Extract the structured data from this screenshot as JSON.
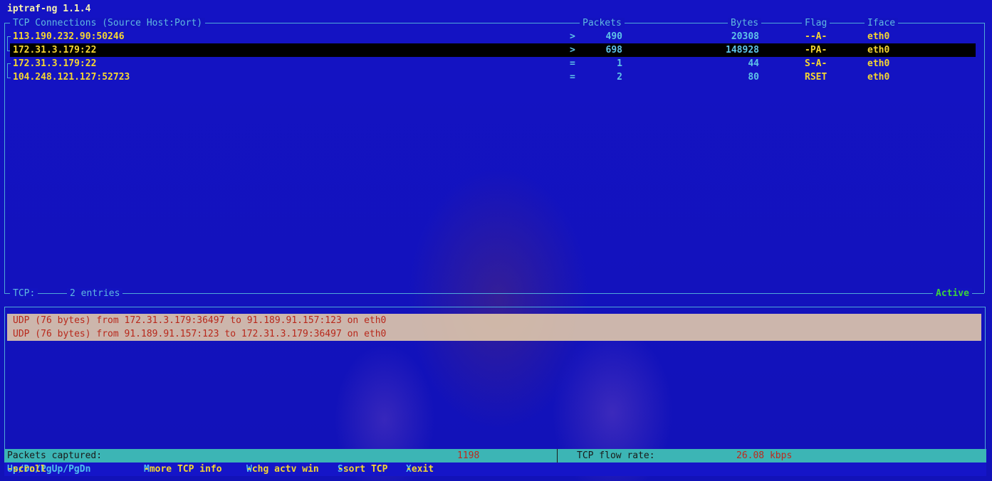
{
  "app": {
    "title": "iptraf-ng 1.1.4"
  },
  "tcp_window": {
    "title": "TCP Connections (Source Host:Port)",
    "columns": {
      "packets": "Packets",
      "bytes": "Bytes",
      "flag": "Flag",
      "iface": "Iface"
    },
    "rows": [
      {
        "host": "113.190.232.90:50246",
        "dir": ">",
        "packets": "490",
        "bytes": "20308",
        "flag": "--A-",
        "iface": "eth0"
      },
      {
        "host": "172.31.3.179:22",
        "dir": ">",
        "packets": "698",
        "bytes": "148928",
        "flag": "-PA-",
        "iface": "eth0"
      },
      {
        "host": "172.31.3.179:22",
        "dir": "=",
        "packets": "1",
        "bytes": "44",
        "flag": "S-A-",
        "iface": "eth0"
      },
      {
        "host": "104.248.121.127:52723",
        "dir": "=",
        "packets": "2",
        "bytes": "80",
        "flag": "RSET",
        "iface": "eth0"
      }
    ],
    "footer_label": "TCP:",
    "footer_entries": "2 entries",
    "footer_status": "Active"
  },
  "other_window": {
    "rows": [
      "UDP (76 bytes) from 172.31.3.179:36497 to 91.189.91.157:123 on eth0",
      "UDP (76 bytes) from 91.189.91.157:123 to 172.31.3.179:36497 on eth0"
    ]
  },
  "status_bar": {
    "packets_label": "Packets captured:",
    "packets_value": "1198",
    "flow_label": "TCP flow rate:",
    "flow_value": "26.08 kbps"
  },
  "help_bar": [
    {
      "key": "Up/Dn/PgUp/PgDn",
      "text": "-scroll"
    },
    {
      "key": "M",
      "text": "-more TCP info"
    },
    {
      "key": "W",
      "text": "-chg actv win"
    },
    {
      "key": "S",
      "text": "-sort TCP"
    },
    {
      "key": "X",
      "text": "-exit"
    }
  ],
  "colors": {
    "background": "#1313c0",
    "highlight_row": "#000000",
    "text_yellow": "#f5d630",
    "text_cyan": "#5fc4e8",
    "active_green": "#3cd43c",
    "status_bar": "#3cb5b5",
    "other_text": "#b8281b"
  }
}
